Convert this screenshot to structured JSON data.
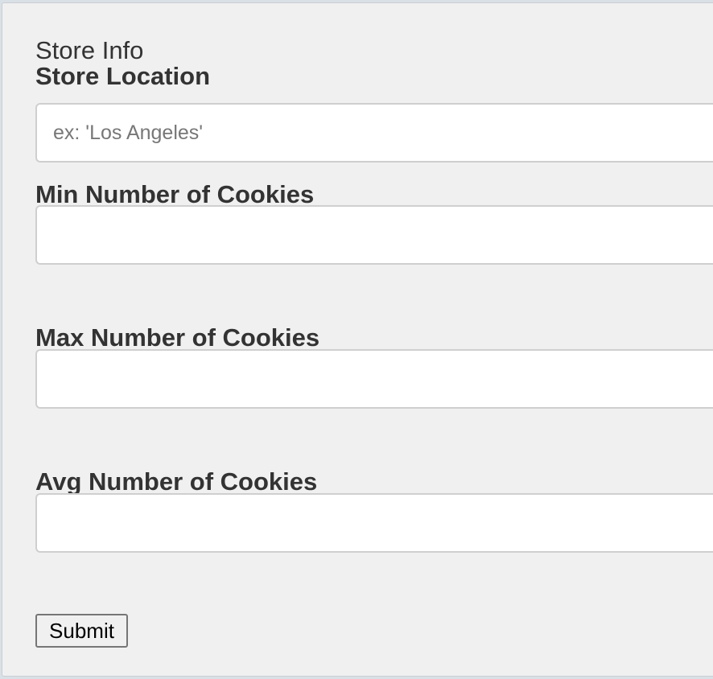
{
  "form": {
    "legend": "Store Info",
    "fields": [
      {
        "label": "Store Location",
        "value": "",
        "placeholder": "ex: 'Los Angeles'"
      },
      {
        "label": "Min Number of Cookies",
        "value": "",
        "placeholder": ""
      },
      {
        "label": "Max Number of Cookies",
        "value": "",
        "placeholder": ""
      },
      {
        "label": "Avg Number of Cookies",
        "value": "",
        "placeholder": ""
      }
    ],
    "submit_label": "Submit"
  },
  "colors": {
    "panel_background": "#f0f0f0",
    "page_background": "#d9e1e6",
    "label_text": "#333333",
    "input_border": "#cfcfcf",
    "placeholder_text": "#777777"
  }
}
